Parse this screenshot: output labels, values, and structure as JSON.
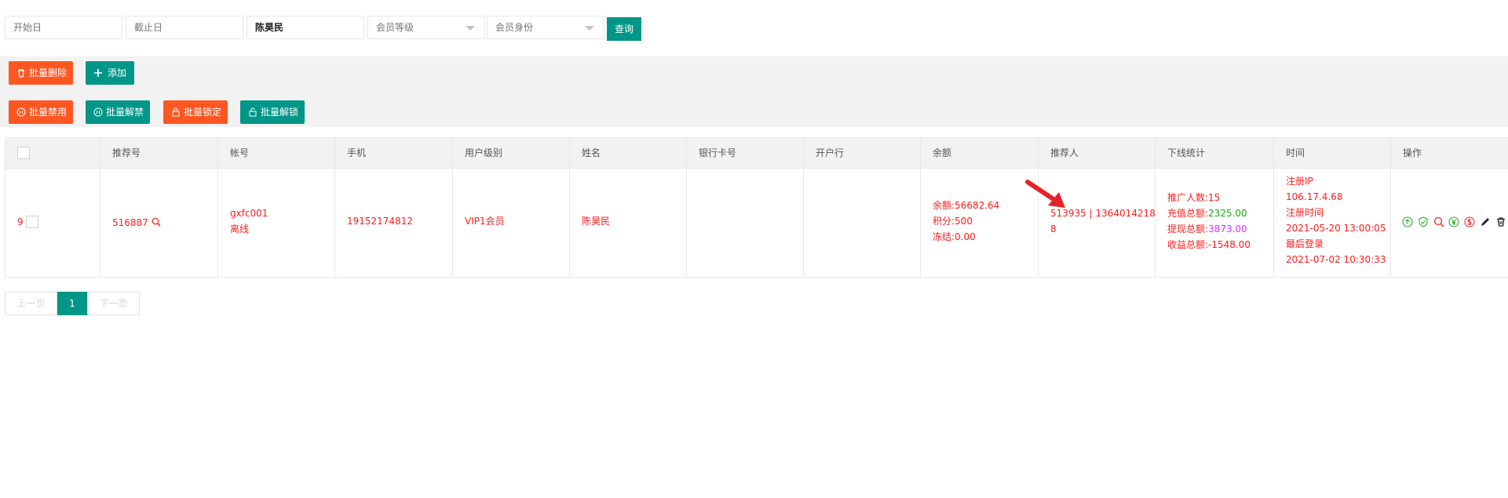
{
  "search": {
    "start_date_placeholder": "开始日",
    "end_date_placeholder": "截止日",
    "name_value": "陈昊民",
    "member_level_placeholder": "会员等级",
    "member_identity_placeholder": "会员身份",
    "query_label": "查询"
  },
  "toolbar": {
    "batch_delete": "批量删除",
    "add": "添加",
    "batch_disable": "批量禁用",
    "batch_enable": "批量解禁",
    "batch_lock": "批量锁定",
    "batch_unlock": "批量解锁"
  },
  "table": {
    "headers": [
      "推荐号",
      "帐号",
      "手机",
      "用户级别",
      "姓名",
      "银行卡号",
      "开户行",
      "余额",
      "推荐人",
      "下线统计",
      "时间",
      "操作"
    ],
    "row": {
      "index": "9",
      "ref_code": "516887",
      "account": "gxfc001",
      "status": "离线",
      "phone": "19152174812",
      "level": "VIP1会员",
      "name": "陈昊民",
      "bank_card": "",
      "bank_branch": "",
      "balance": "余额:56682.64",
      "points": "积分:500",
      "frozen": "冻结:0.00",
      "referrer_line1": "513935 | 1364014218",
      "referrer_line2": "8",
      "downline_count": "推广人数:15",
      "recharge_label": "充值总额:",
      "recharge_value": "2325.00",
      "withdraw_label": "提现总额:",
      "withdraw_value": "3873.00",
      "profit": "收益总额:-1548.00",
      "reg_ip_label": "注册IP",
      "reg_ip": "106.17.4.68",
      "reg_time_label": "注册时间",
      "reg_time": "2021-05-20 13:00:05",
      "last_login_label": "最后登录",
      "last_login": "2021-07-02 10:30:33"
    }
  },
  "pagination": {
    "prev": "上一页",
    "current": "1",
    "next": "下一页"
  },
  "colors": {
    "accent": "#009688",
    "warning": "#ff5722",
    "row_text": "#ff1c1c",
    "recharge": "#1aa81a",
    "withdraw": "#d633ff"
  }
}
